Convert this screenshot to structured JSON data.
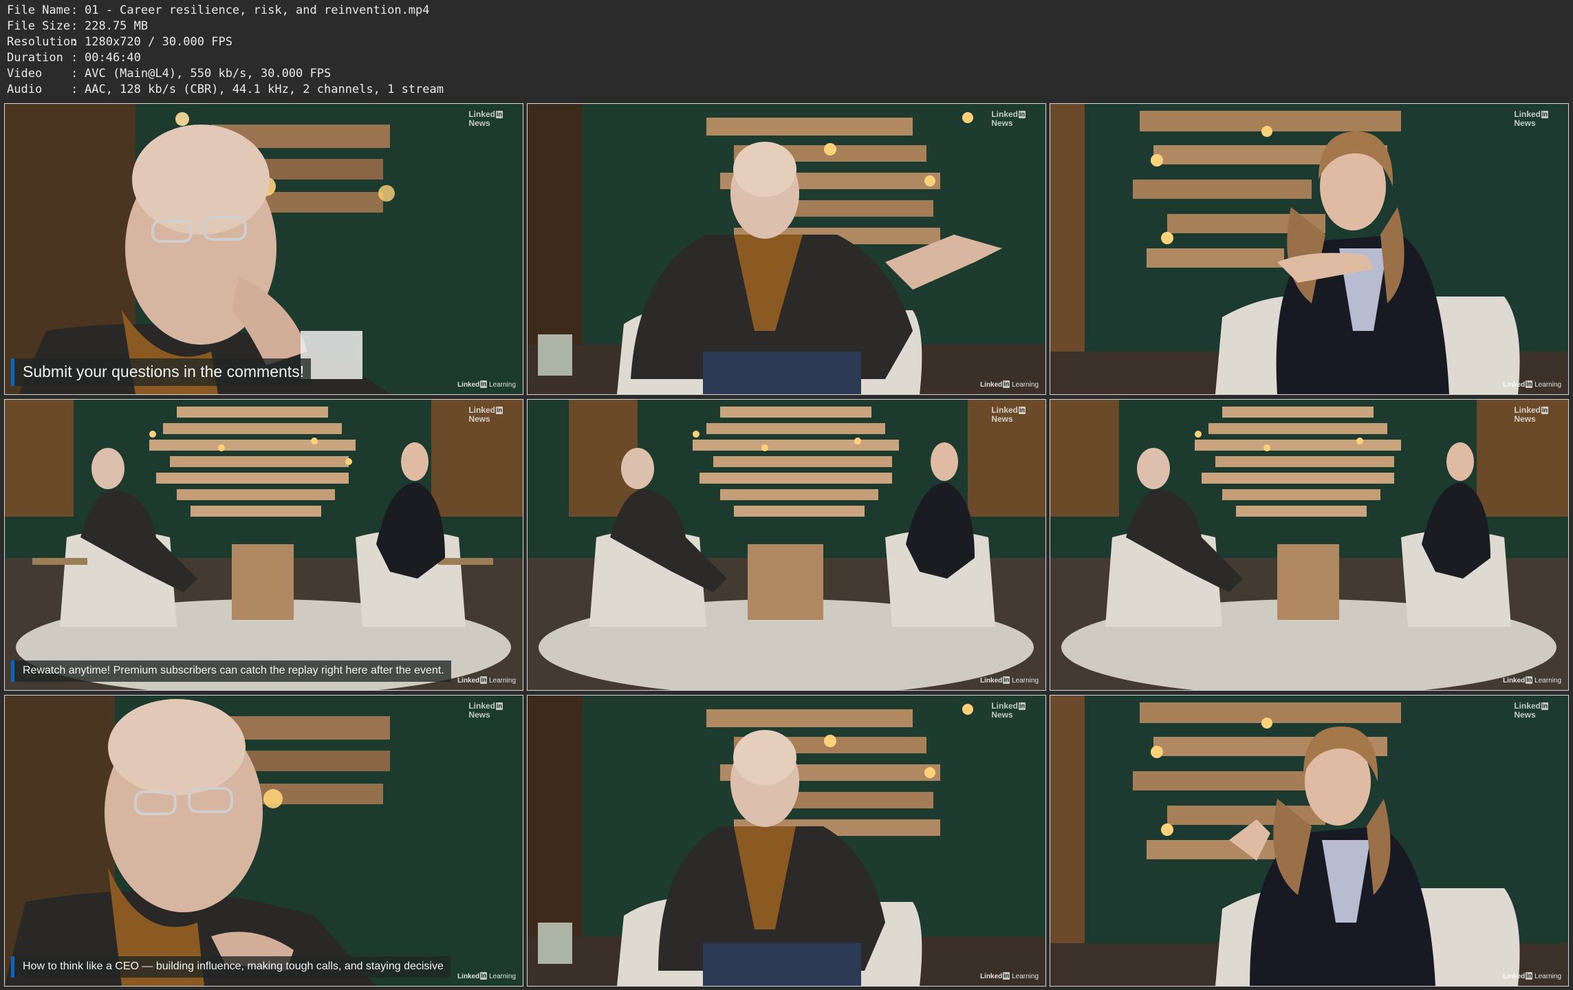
{
  "info": [
    {
      "key": "File Name",
      "sep": ":",
      "value": "01 - Career resilience, risk, and reinvention.mp4"
    },
    {
      "key": "File Size",
      "sep": ":",
      "value": "228.75 MB"
    },
    {
      "key": "Resolution",
      "sep": ":",
      "value": "1280x720 / 30.000 FPS"
    },
    {
      "key": "Duration",
      "sep": ":",
      "value": "00:46:40"
    },
    {
      "key": "Video",
      "sep": ":",
      "value": "AVC (Main@L4), 550 kb/s, 30.000 FPS"
    },
    {
      "key": "Audio",
      "sep": ":",
      "value": "AAC, 128 kb/s (CBR), 44.1 kHz, 2 channels, 1 stream"
    }
  ],
  "logo": {
    "news_top": "Linked",
    "news_in": "in",
    "news_bottom": "News",
    "learn_brand": "Linked",
    "learn_in": "in",
    "learn_text": "Learning"
  },
  "captions": {
    "t1": "Submit your questions in the comments!",
    "t4": "Rewatch anytime! Premium subscribers can catch the replay right here after the event.",
    "t7": "How to think like a CEO — building influence, making tough calls, and staying decisive"
  },
  "colors": {
    "background": "#2b2b2b",
    "studio_wall": "#1d3a2f",
    "accent": "#0a66c2"
  }
}
